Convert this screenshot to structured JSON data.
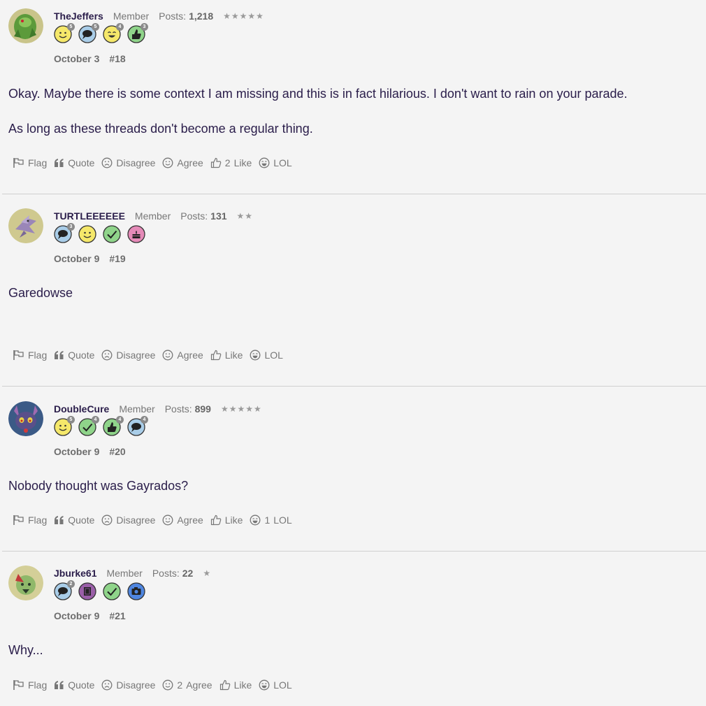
{
  "posts": [
    {
      "username": "TheJeffers",
      "role": "Member",
      "posts_label": "Posts:",
      "posts_count": "1,218",
      "stars": "★★★★★",
      "date": "October 3",
      "post_number": "#18",
      "content": [
        "Okay. Maybe there is some context I am missing and this is in fact hilarious. I don't want to rain on your parade.",
        "As long as these threads don't become a regular thing."
      ],
      "badges": [
        {
          "icon": "smiley-badge-icon",
          "count": "5"
        },
        {
          "icon": "speech-bubble-badge-icon",
          "count": "5"
        },
        {
          "icon": "laugh-badge-icon",
          "count": "4"
        },
        {
          "icon": "thumbs-up-badge-icon",
          "count": "3"
        }
      ],
      "actions": {
        "flag": "Flag",
        "quote": "Quote",
        "disagree": "Disagree",
        "agree": "Agree",
        "like": "Like",
        "lol": "LOL",
        "like_count": "2",
        "agree_count": "",
        "lol_count": ""
      }
    },
    {
      "username": "TURTLEEEEEE",
      "role": "Member",
      "posts_label": "Posts:",
      "posts_count": "131",
      "stars": "★★",
      "date": "October 9",
      "post_number": "#19",
      "content": [
        "Garedowse"
      ],
      "badges": [
        {
          "icon": "speech-bubble-badge-icon",
          "count": "3"
        },
        {
          "icon": "smiley-badge-icon",
          "count": ""
        },
        {
          "icon": "checkmark-badge-icon",
          "count": ""
        },
        {
          "icon": "cake-badge-icon",
          "count": ""
        }
      ],
      "actions": {
        "flag": "Flag",
        "quote": "Quote",
        "disagree": "Disagree",
        "agree": "Agree",
        "like": "Like",
        "lol": "LOL",
        "like_count": "",
        "agree_count": "",
        "lol_count": ""
      }
    },
    {
      "username": "DoubleCure",
      "role": "Member",
      "posts_label": "Posts:",
      "posts_count": "899",
      "stars": "★★★★★",
      "date": "October 9",
      "post_number": "#20",
      "content": [
        "Nobody thought was Gayrados?"
      ],
      "badges": [
        {
          "icon": "smiley-badge-icon",
          "count": "5"
        },
        {
          "icon": "checkmark-badge-icon",
          "count": "4"
        },
        {
          "icon": "thumbs-up-badge-icon",
          "count": "4"
        },
        {
          "icon": "speech-bubble-badge-icon",
          "count": "4"
        }
      ],
      "actions": {
        "flag": "Flag",
        "quote": "Quote",
        "disagree": "Disagree",
        "agree": "Agree",
        "like": "Like",
        "lol": "LOL",
        "like_count": "",
        "agree_count": "",
        "lol_count": "1"
      }
    },
    {
      "username": "Jburke61",
      "role": "Member",
      "posts_label": "Posts:",
      "posts_count": "22",
      "stars": "★",
      "date": "October 9",
      "post_number": "#21",
      "content": [
        "Why..."
      ],
      "badges": [
        {
          "icon": "speech-bubble-badge-icon",
          "count": "2"
        },
        {
          "icon": "book-badge-icon",
          "count": ""
        },
        {
          "icon": "checkmark-badge-icon",
          "count": ""
        },
        {
          "icon": "camera-badge-icon",
          "count": ""
        }
      ],
      "actions": {
        "flag": "Flag",
        "quote": "Quote",
        "disagree": "Disagree",
        "agree": "Agree",
        "like": "Like",
        "lol": "LOL",
        "like_count": "",
        "agree_count": "2",
        "lol_count": ""
      }
    }
  ],
  "colors": {
    "background": "#f4f4f4",
    "text": "#2a1d4a",
    "muted": "#777777",
    "divider": "#cfcfcf"
  }
}
